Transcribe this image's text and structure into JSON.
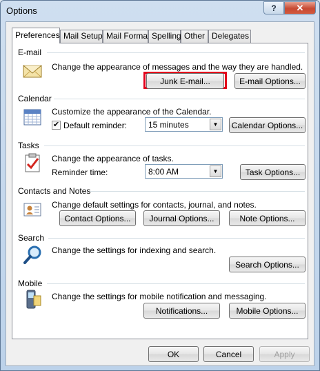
{
  "window": {
    "title": "Options",
    "help_glyph": "?",
    "close_glyph": "✕"
  },
  "tabs": [
    {
      "label": "Preferences",
      "active": true
    },
    {
      "label": "Mail Setup"
    },
    {
      "label": "Mail Format"
    },
    {
      "label": "Spelling"
    },
    {
      "label": "Other"
    },
    {
      "label": "Delegates"
    }
  ],
  "email": {
    "heading": "E-mail",
    "icon": "envelope-icon",
    "description": "Change the appearance of messages and the way they are handled.",
    "junk_button": "Junk E-mail...",
    "options_button": "E-mail Options..."
  },
  "calendar": {
    "heading": "Calendar",
    "icon": "calendar-icon",
    "description": "Customize the appearance of the Calendar.",
    "reminder_label": "Default reminder:",
    "reminder_checked": true,
    "reminder_value": "15 minutes",
    "options_button": "Calendar Options..."
  },
  "tasks": {
    "heading": "Tasks",
    "icon": "task-clipboard-icon",
    "description": "Change the appearance of tasks.",
    "reminder_label": "Reminder time:",
    "reminder_value": "8:00 AM",
    "options_button": "Task Options..."
  },
  "contacts": {
    "heading": "Contacts and Notes",
    "icon": "contact-card-icon",
    "description": "Change default settings for contacts, journal, and notes.",
    "contact_button": "Contact Options...",
    "journal_button": "Journal Options...",
    "note_button": "Note Options..."
  },
  "search": {
    "heading": "Search",
    "icon": "magnifier-icon",
    "description": "Change the settings for indexing and search.",
    "options_button": "Search Options..."
  },
  "mobile": {
    "heading": "Mobile",
    "icon": "mobile-phone-icon",
    "description": "Change the settings for mobile notification and messaging.",
    "notifications_button": "Notifications...",
    "options_button": "Mobile Options..."
  },
  "footer": {
    "ok": "OK",
    "cancel": "Cancel",
    "apply": "Apply"
  },
  "colors": {
    "highlight": "#e3001b",
    "window_frame": "#bcd2ea",
    "section_line": "#d5dfe5"
  }
}
